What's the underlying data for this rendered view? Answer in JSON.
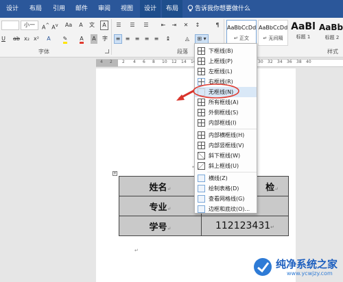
{
  "tabs": [
    "设计",
    "布局",
    "引用",
    "邮件",
    "审阅",
    "视图",
    "设计",
    "布局"
  ],
  "tell_me": "告诉我你想要做什么",
  "ribbon": {
    "font_name": "",
    "font_size": "小一",
    "groups": [
      "字体",
      "段落",
      "样式"
    ],
    "styles": [
      {
        "preview": "AaBbCcDd",
        "caption": "↵ 正文"
      },
      {
        "preview": "AaBbCcDd",
        "caption": "↵ 无间隔"
      },
      {
        "preview": "AaBl",
        "caption": "标题 1"
      },
      {
        "preview": "AaBbl",
        "caption": "标题 2"
      }
    ]
  },
  "ruler_numbers": [
    "4",
    "2",
    "2",
    "4",
    "6",
    "8",
    "10",
    "12",
    "14",
    "16",
    "18",
    "20",
    "22",
    "24",
    "26",
    "28",
    "30",
    "32",
    "34",
    "36",
    "38",
    "40"
  ],
  "border_menu": [
    "下框线(B)",
    "上框线(P)",
    "左框线(L)",
    "右框线(R)",
    "无框线(N)",
    "所有框线(A)",
    "外侧框线(S)",
    "内部框线(I)",
    "内部横框线(H)",
    "内部竖框线(V)",
    "斜下框线(W)",
    "斜上框线(U)",
    "横线(Z)",
    "绘制表格(D)",
    "查看网格线(G)",
    "边框和底纹(O)..."
  ],
  "table": [
    [
      "姓名",
      "检"
    ],
    [
      "专业",
      ""
    ],
    [
      "学号",
      "112123431"
    ]
  ],
  "watermark": {
    "title": "纯净系统之家",
    "url": "www.ycwjzy.com"
  },
  "colors": {
    "tabbar": "#2b579a",
    "highlight_circle": "#e03a2f",
    "arrow": "#d9342b"
  }
}
